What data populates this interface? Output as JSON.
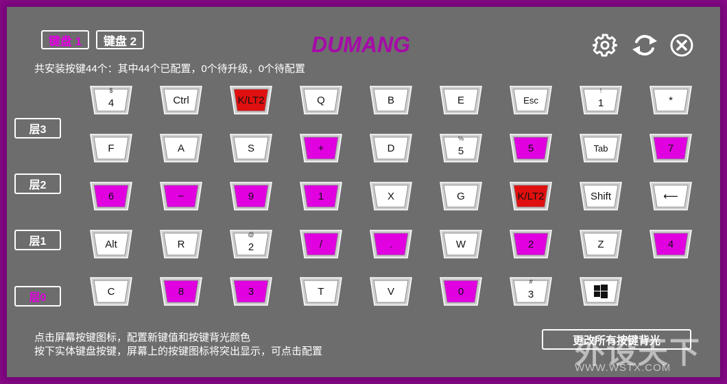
{
  "colors": {
    "accent": "#e000e0",
    "highlight_red": "#e01010",
    "key_face": "#ffffff",
    "panel": "#6d6d6d",
    "frame": "#8a0c8b"
  },
  "header": {
    "tabs": [
      {
        "label": "键盘 1",
        "active": true
      },
      {
        "label": "键盘 2",
        "active": false
      }
    ],
    "logo": "DUMANG",
    "icons": [
      "gear-icon",
      "refresh-icon",
      "close-icon"
    ]
  },
  "summary": "共安装按键44个：其中44个已配置，0个待升级，0个待配置",
  "layers": [
    {
      "label": "层3",
      "active": false
    },
    {
      "label": "层2",
      "active": false
    },
    {
      "label": "层1",
      "active": false
    },
    {
      "label": "层0",
      "active": true
    }
  ],
  "keys": [
    [
      {
        "label": "4",
        "shift": "$",
        "color": "white"
      },
      {
        "label": "Ctrl",
        "color": "white"
      },
      {
        "label": "K/LT2",
        "color": "red"
      },
      {
        "label": "Q",
        "color": "white"
      },
      {
        "label": "B",
        "color": "white"
      },
      {
        "label": "E",
        "color": "white"
      },
      {
        "label": "Esc",
        "color": "white",
        "small": true
      },
      {
        "label": "1",
        "shift": "!",
        "color": "white"
      },
      {
        "label": "*",
        "color": "white"
      }
    ],
    [
      {
        "label": "F",
        "color": "white"
      },
      {
        "label": "A",
        "color": "white"
      },
      {
        "label": "S",
        "color": "white"
      },
      {
        "label": "+",
        "color": "magenta"
      },
      {
        "label": "D",
        "color": "white"
      },
      {
        "label": "5",
        "shift": "%",
        "color": "white"
      },
      {
        "label": "5",
        "color": "magenta"
      },
      {
        "label": "Tab",
        "color": "white",
        "small": true
      },
      {
        "label": "7",
        "color": "magenta"
      }
    ],
    [
      {
        "label": "6",
        "color": "magenta"
      },
      {
        "label": "−",
        "color": "magenta"
      },
      {
        "label": "9",
        "color": "magenta"
      },
      {
        "label": "1",
        "color": "magenta"
      },
      {
        "label": "X",
        "color": "white"
      },
      {
        "label": "G",
        "color": "white"
      },
      {
        "label": "K/LT2",
        "color": "red"
      },
      {
        "label": "Shift",
        "color": "white"
      },
      {
        "label": "⟵",
        "color": "white"
      }
    ],
    [
      {
        "label": "Alt",
        "color": "white"
      },
      {
        "label": "R",
        "color": "white"
      },
      {
        "label": "2",
        "shift": "@",
        "color": "white"
      },
      {
        "label": "/",
        "color": "magenta"
      },
      {
        "label": ".",
        "color": "magenta"
      },
      {
        "label": "W",
        "color": "white"
      },
      {
        "label": "2",
        "color": "magenta"
      },
      {
        "label": "Z",
        "color": "white"
      },
      {
        "label": "4",
        "color": "magenta"
      }
    ],
    [
      {
        "label": "C",
        "color": "white"
      },
      {
        "label": "8",
        "color": "magenta"
      },
      {
        "label": "3",
        "color": "magenta"
      },
      {
        "label": "T",
        "color": "white"
      },
      {
        "label": "V",
        "color": "white"
      },
      {
        "label": "0",
        "color": "magenta"
      },
      {
        "label": "3",
        "shift": "#",
        "color": "white"
      },
      {
        "label": "",
        "icon": "windows-icon",
        "color": "white"
      }
    ]
  ],
  "footer": {
    "line1": "点击屏幕按键图标，配置新键值和按键背光颜色",
    "line2": "按下实体键盘按键，屏幕上的按键图标将突出显示，可点击配置",
    "all_backlight_label": "更改所有按键背光"
  },
  "watermark": {
    "big": "外设天下",
    "url": "WWW.WSTX.COM"
  }
}
